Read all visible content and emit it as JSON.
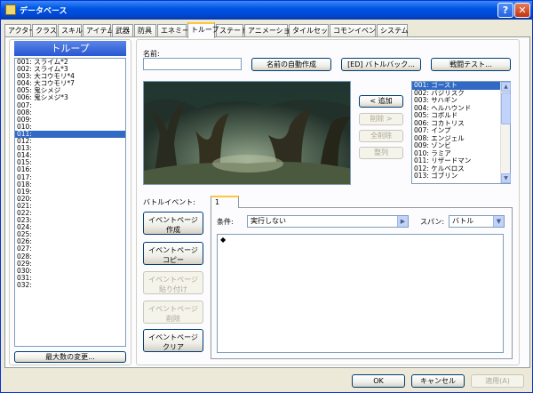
{
  "window": {
    "title": "データベース",
    "help_glyph": "?",
    "close_glyph": "✕"
  },
  "tabs": [
    "アクター",
    "クラス",
    "スキル",
    "アイテム",
    "武器",
    "防具",
    "エネミー",
    "トループ",
    "ステート",
    "アニメーション",
    "タイルセット",
    "コモンイベント",
    "システム"
  ],
  "active_tab": "トループ",
  "troop_list": {
    "header": "トループ",
    "items": [
      "001: スライム*2",
      "002: スライム*3",
      "003: 大コウモリ*4",
      "004: 大コウモリ*7",
      "005: 鬼シメジ",
      "006: 鬼シメジ*3",
      "007:",
      "008:",
      "009:",
      "010:",
      "011:",
      "012:",
      "013:",
      "014:",
      "015:",
      "016:",
      "017:",
      "018:",
      "019:",
      "020:",
      "021:",
      "022:",
      "023:",
      "024:",
      "025:",
      "026:",
      "027:",
      "028:",
      "029:",
      "030:",
      "031:",
      "032:"
    ],
    "selected_index": 10,
    "max_button": "最大数の変更..."
  },
  "name_field": {
    "label": "名前:",
    "value": ""
  },
  "top_buttons": {
    "auto_name": "名前の自動作成",
    "battleback": "[ED] バトルバック...",
    "battle_test": "戦闘テスト..."
  },
  "member_buttons": {
    "add": "< 追加",
    "remove": "削除 >",
    "clear": "全削除",
    "arrange": "整列"
  },
  "enemy_list": {
    "items": [
      "001: ゴースト",
      "002: バジリスク",
      "003: サハギン",
      "004: ヘルハウンド",
      "005: コボルド",
      "006: コカトリス",
      "007: インプ",
      "008: エンジェル",
      "009: ゾンビ",
      "010: ラミア",
      "011: リザードマン",
      "012: ケルベロス",
      "013: ゴブリン"
    ],
    "selected_index": 0,
    "scroll_up": "▲",
    "scroll_down": "▼"
  },
  "battle_event": {
    "label": "バトルイベント:",
    "page_tab": "1",
    "buttons": [
      "イベントページ|作成",
      "イベントページ|コピー",
      "イベントページ|貼り付け",
      "イベントページ|削除",
      "イベントページ|クリア"
    ],
    "condition_label": "条件:",
    "condition_value": "実行しない",
    "condition_arrow": "▶",
    "span_label": "スパン:",
    "span_value": "バトル",
    "span_arrow": "▼",
    "command_marker": "◆"
  },
  "footer": {
    "ok": "OK",
    "cancel": "キャンセル",
    "apply": "適用(A)"
  },
  "colors": {
    "selection": "#316ac5",
    "title_blue": "#0055e5",
    "panel_bg": "#fcfcfe",
    "window_bg": "#ece9d8"
  },
  "icons": {
    "window": "database-app-icon",
    "help": "help-icon",
    "close": "close-icon"
  }
}
